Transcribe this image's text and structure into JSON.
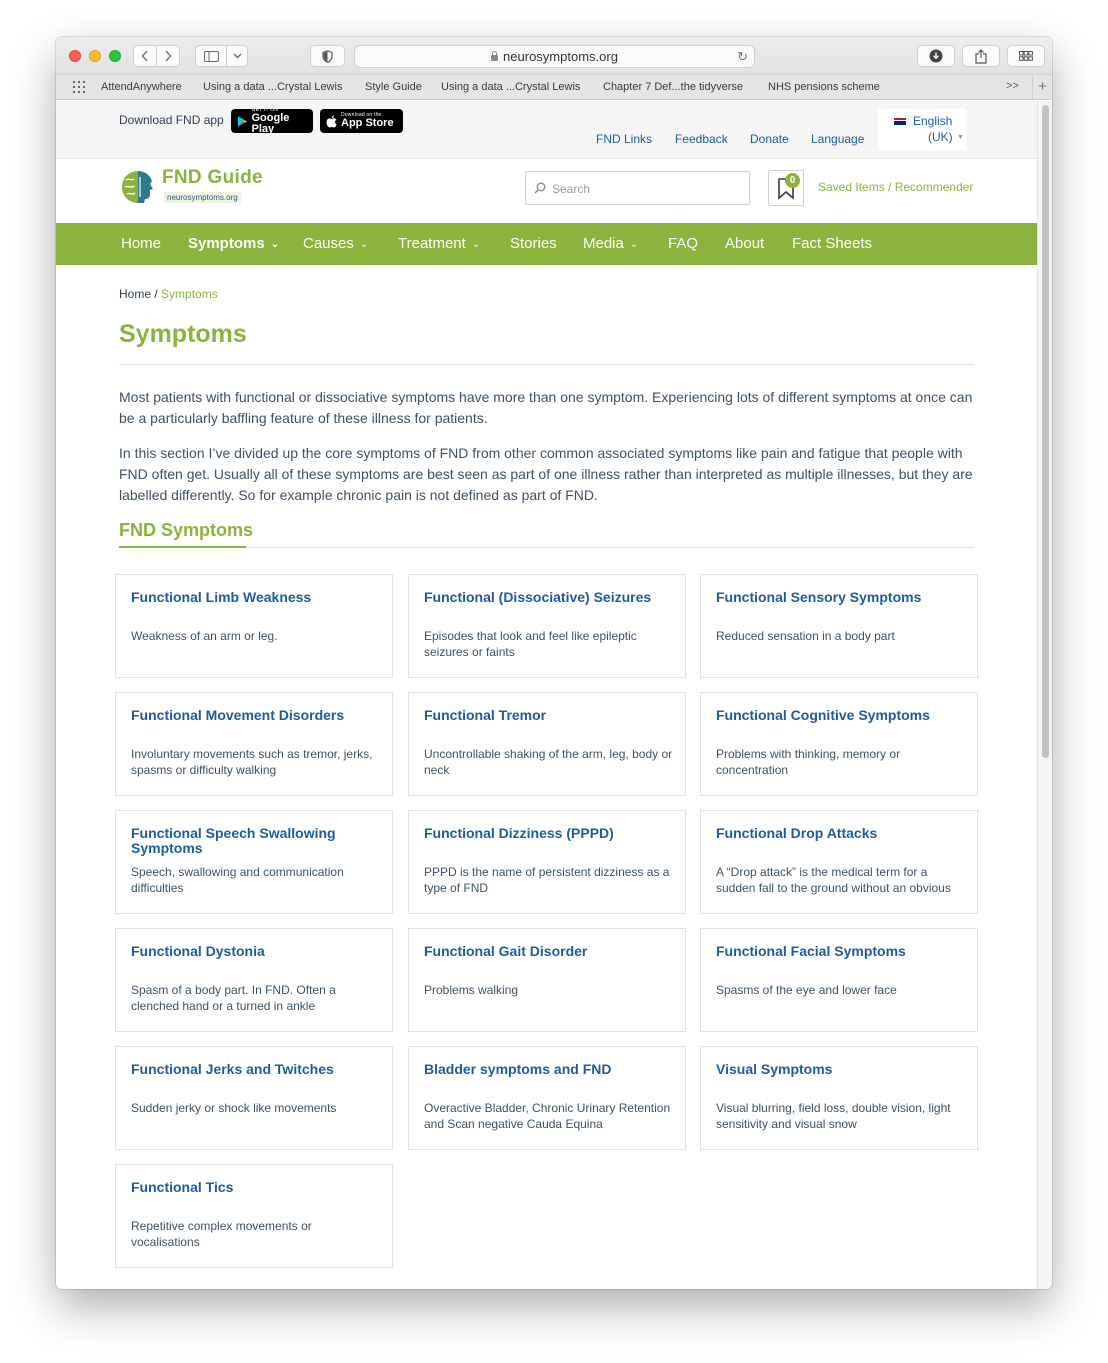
{
  "browser": {
    "url": "neurosymptoms.org",
    "bookmarks": [
      "AttendAnywhere",
      "Using a data ...Crystal Lewis",
      "Style Guide",
      "Using a data ...Crystal Lewis",
      "Chapter 7 Def...the tidyverse",
      "NHS pensions scheme"
    ],
    "more": ">>",
    "plus": "+"
  },
  "topbar": {
    "download_label": "Download FND app",
    "google_play": {
      "small": "GET IT ON",
      "big": "Google Play"
    },
    "app_store": {
      "small": "Download on the",
      "big": "App Store"
    },
    "links": [
      "FND Links",
      "Feedback",
      "Donate",
      "Language"
    ],
    "language": {
      "name": "English",
      "sub": "(UK)"
    }
  },
  "header": {
    "logo_title": "FND Guide",
    "logo_sub": "neurosymptoms.org",
    "search_placeholder": "Search",
    "saved_count": "0",
    "saved_label": "Saved Items / Recommender"
  },
  "nav": [
    {
      "label": "Home",
      "caret": false
    },
    {
      "label": "Symptoms",
      "caret": true
    },
    {
      "label": "Causes",
      "caret": true
    },
    {
      "label": "Treatment",
      "caret": true
    },
    {
      "label": "Stories",
      "caret": false
    },
    {
      "label": "Media",
      "caret": true
    },
    {
      "label": "FAQ",
      "caret": false
    },
    {
      "label": "About",
      "caret": false
    },
    {
      "label": "Fact Sheets",
      "caret": false
    }
  ],
  "breadcrumb": {
    "home": "Home",
    "sep": " / ",
    "current": "Symptoms"
  },
  "page": {
    "title": "Symptoms",
    "intro1": "Most patients with functional or dissociative symptoms have more than one symptom. Experiencing lots of different symptoms at once can be a particularly baffling feature of these illness for patients.",
    "intro2": "In this section I’ve divided up the core symptoms of FND from other common associated symptoms like pain and fatigue that people with FND often get. Usually all of these symptoms are best seen as part of one illness rather than interpreted as multiple illnesses, but they are labelled differently. So for example chronic pain is not defined as part of FND.",
    "section_title": "FND Symptoms"
  },
  "cards": [
    {
      "title": "Functional Limb Weakness",
      "desc": "Weakness of an arm or leg."
    },
    {
      "title": "Functional (Dissociative) Seizures",
      "desc": "Episodes that look and feel like epileptic seizures or faints"
    },
    {
      "title": "Functional Sensory Symptoms",
      "desc": "Reduced sensation in a body part"
    },
    {
      "title": "Functional Movement Disorders",
      "desc": "Involuntary movements such as tremor, jerks, spasms or difficulty walking"
    },
    {
      "title": "Functional Tremor",
      "desc": "Uncontrollable shaking of the arm, leg, body or neck"
    },
    {
      "title": "Functional Cognitive Symptoms",
      "desc": "Problems with thinking, memory or concentration"
    },
    {
      "title": "Functional Speech Swallowing Symptoms",
      "desc": "Speech, swallowing and communication difficulties"
    },
    {
      "title": "Functional Dizziness (PPPD)",
      "desc": "PPPD is the name of persistent dizziness as a type of FND"
    },
    {
      "title": "Functional Drop Attacks",
      "desc": "A “Drop attack” is the medical term for a sudden fall to the ground without an obvious"
    },
    {
      "title": "Functional Dystonia",
      "desc": "Spasm of a body part. In FND. Often a clenched hand or a turned in ankle"
    },
    {
      "title": "Functional Gait Disorder",
      "desc": "Problems walking"
    },
    {
      "title": "Functional Facial Symptoms",
      "desc": "Spasms of the eye and lower face"
    },
    {
      "title": "Functional Jerks and Twitches",
      "desc": "Sudden jerky or shock like movements"
    },
    {
      "title": "Bladder symptoms and FND",
      "desc": "Overactive Bladder, Chronic Urinary Retention and Scan negative Cauda Equina"
    },
    {
      "title": "Visual Symptoms",
      "desc": "Visual blurring, field loss, double vision, light sensitivity and visual snow"
    },
    {
      "title": "Functional Tics",
      "desc": "Repetitive complex movements or vocalisations"
    }
  ],
  "colors": {
    "brand_green": "#8bb33d",
    "link_blue": "#1f5c9e",
    "text": "#3e5266"
  }
}
